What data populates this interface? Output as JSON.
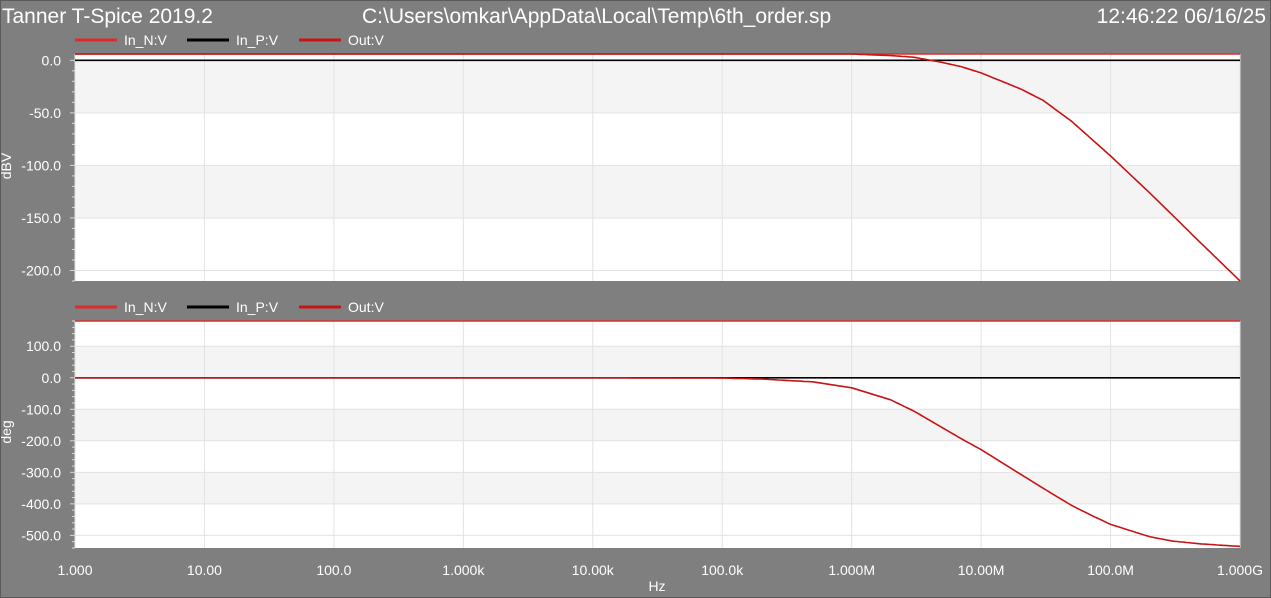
{
  "header": {
    "app_title": "Tanner T-Spice 2019.2",
    "file_path": "C:\\Users\\omkar\\AppData\\Local\\Temp\\6th_order.sp",
    "timestamp": "12:46:22 06/16/25"
  },
  "colors": {
    "background": "#7f7f7f",
    "plot_area": "#ffffff",
    "band": "#f4f4f4",
    "grid": "#e2e2e2",
    "in_n": "#e02b2b",
    "in_p": "#000000",
    "out": "#c81414",
    "text": "#ffffff"
  },
  "chart_data": [
    {
      "type": "line",
      "ylabel": "dBV",
      "xlabel": "",
      "x_scale": "log",
      "xlim": [
        1,
        1000000000
      ],
      "ylim": [
        -210,
        6
      ],
      "yticks": [
        0,
        -50,
        -100,
        -150,
        -200
      ],
      "ytick_labels": [
        "0.0",
        "-50.0",
        "-100.0",
        "-150.0",
        "-200.0"
      ],
      "grid": true,
      "legend_position": "top-left",
      "series": [
        {
          "name": "In_N:V",
          "color": "#e02b2b",
          "x": [
            1,
            1000000000
          ],
          "y": [
            6,
            6
          ]
        },
        {
          "name": "In_P:V",
          "color": "#000000",
          "x": [
            1,
            1000000000
          ],
          "y": [
            0,
            0
          ]
        },
        {
          "name": "Out:V",
          "color": "#c81414",
          "x": [
            1,
            100000,
            1000000,
            2000000,
            3000000,
            5000000,
            7000000,
            10000000,
            20000000,
            30000000,
            50000000,
            70000000,
            100000000,
            200000000,
            500000000,
            1000000000
          ],
          "y": [
            6,
            6,
            6,
            4.5,
            3,
            -2,
            -6,
            -12,
            -27,
            -38,
            -58,
            -74,
            -91,
            -126,
            -174,
            -210
          ]
        }
      ]
    },
    {
      "type": "line",
      "ylabel": "deg",
      "xlabel": "Hz",
      "x_scale": "log",
      "xlim": [
        1,
        1000000000
      ],
      "ylim": [
        -540,
        180
      ],
      "yticks": [
        100,
        0,
        -100,
        -200,
        -300,
        -400,
        -500
      ],
      "ytick_labels": [
        "100.0",
        "0.0",
        "-100.0",
        "-200.0",
        "-300.0",
        "-400.0",
        "-500.0"
      ],
      "xticks": [
        1,
        10,
        100,
        1000,
        10000,
        100000,
        1000000,
        10000000,
        100000000,
        1000000000
      ],
      "xtick_labels": [
        "1.000",
        "10.00",
        "100.0",
        "1.000k",
        "10.00k",
        "100.0k",
        "1.000M",
        "10.00M",
        "100.0M",
        "1.000G"
      ],
      "grid": true,
      "legend_position": "top-left",
      "series": [
        {
          "name": "In_N:V",
          "color": "#e02b2b",
          "x": [
            1,
            1000000000
          ],
          "y": [
            180,
            180
          ]
        },
        {
          "name": "In_P:V",
          "color": "#000000",
          "x": [
            1,
            1000000000
          ],
          "y": [
            0,
            0
          ]
        },
        {
          "name": "Out:V",
          "color": "#c81414",
          "x": [
            1,
            10000,
            100000,
            200000,
            500000,
            1000000,
            2000000,
            3000000,
            5000000,
            7000000,
            10000000,
            20000000,
            30000000,
            50000000,
            70000000,
            100000000,
            200000000,
            300000000,
            500000000,
            1000000000
          ],
          "y": [
            0,
            0,
            -1,
            -4,
            -13,
            -32,
            -70,
            -105,
            -158,
            -193,
            -228,
            -305,
            -350,
            -405,
            -435,
            -465,
            -504,
            -518,
            -527,
            -535
          ]
        }
      ]
    }
  ]
}
